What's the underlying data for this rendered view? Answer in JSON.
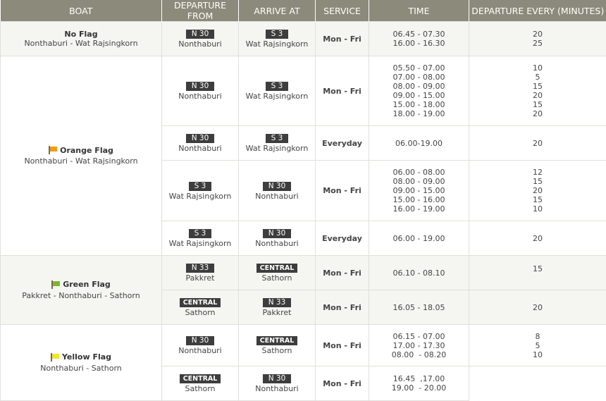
{
  "headers": [
    "BOAT",
    "DEPARTURE FROM",
    "ARRIVE AT",
    "SERVICE",
    "TIME",
    "DEPARTURE EVERY (MINUTES)"
  ],
  "colors": {
    "header_bg": "#8c8a7b",
    "orange_flag": "#f29a1a",
    "green_flag": "#7cb82f",
    "yellow_flag": "#f2e52a"
  },
  "groups": [
    {
      "name": "No Flag",
      "route": "Nonthaburi - Wat Rajsingkorn",
      "flag_icon": "none",
      "rows": [
        {
          "from_code": "N 30",
          "from_name": "Nonthaburi",
          "to_code": "S  3",
          "to_name": "Wat Rajsingkorn",
          "service": "Mon - Fri",
          "time": "06.45 - 07.30\n16.00 - 16.30",
          "every": "20\n25"
        }
      ]
    },
    {
      "name": "Orange Flag",
      "route": "Nonthaburi - Wat Rajsingkorn",
      "flag_icon": "orange-flag-icon",
      "rows": [
        {
          "from_code": "N 30",
          "from_name": "Nonthaburi",
          "to_code": "S  3",
          "to_name": "Wat Rajsingkorn",
          "service": "Mon - Fri",
          "time": "05.50 - 07.00\n07.00 - 08.00\n08.00 - 09.00\n09.00 - 15.00\n15.00 - 18.00\n18.00 - 19.00",
          "every": "10\n5\n15\n20\n15\n20"
        },
        {
          "from_code": "N 30",
          "from_name": "Nonthaburi",
          "to_code": "S  3",
          "to_name": "Wat Rajsingkorn",
          "service": "Everyday",
          "time": "06.00-19.00",
          "every": "20"
        },
        {
          "from_code": "S  3",
          "from_name": "Wat Rajsingkorn",
          "to_code": "N 30",
          "to_name": "Nonthaburi",
          "service": "Mon - Fri",
          "time": "06.00 - 08.00\n08.00 - 09.00\n09.00 - 15.00\n15.00 - 16.00\n16.00 - 19.00",
          "every": "12\n15\n20\n15\n10"
        },
        {
          "from_code": "S  3",
          "from_name": "Wat Rajsingkorn",
          "to_code": "N 30",
          "to_name": "Nonthaburi",
          "service": "Everyday",
          "time": "06.00 - 19.00",
          "every": "20"
        }
      ]
    },
    {
      "name": "Green Flag",
      "route": "Pakkret - Nonthaburi - Sathorn",
      "flag_icon": "green-flag-icon",
      "rows": [
        {
          "from_code": "N 33",
          "from_name": "Pakkret",
          "to_code": "CENTRAL",
          "to_name": "Sathorn",
          "service": "Mon - Fri",
          "time": "06.10 - 08.10",
          "every": "15"
        },
        {
          "from_code": "CENTRAL",
          "from_name": "Sathorn",
          "to_code": "N 33",
          "to_name": "Pakkret",
          "service": "Mon - Fri",
          "time": "16.05 - 18.05",
          "every": "20"
        }
      ]
    },
    {
      "name": "Yellow Flag",
      "route": "Nonthaburi - Sathorn",
      "flag_icon": "yellow-flag-icon",
      "rows": [
        {
          "from_code": "N 30",
          "from_name": "Nonthaburi",
          "to_code": "CENTRAL",
          "to_name": "Sathorn",
          "service": "Mon - Fri",
          "time": "06.15 - 07.00\n17.00 - 17.30\n08.00  - 08.20",
          "every": "8\n5\n10"
        },
        {
          "from_code": "CENTRAL",
          "from_name": "Sathorn",
          "to_code": "N 30",
          "to_name": "Nonthaburi",
          "service": "Mon - Fri",
          "time": "16.45  ,17.00\n19.00  - 20.00",
          "every": ""
        }
      ]
    }
  ]
}
